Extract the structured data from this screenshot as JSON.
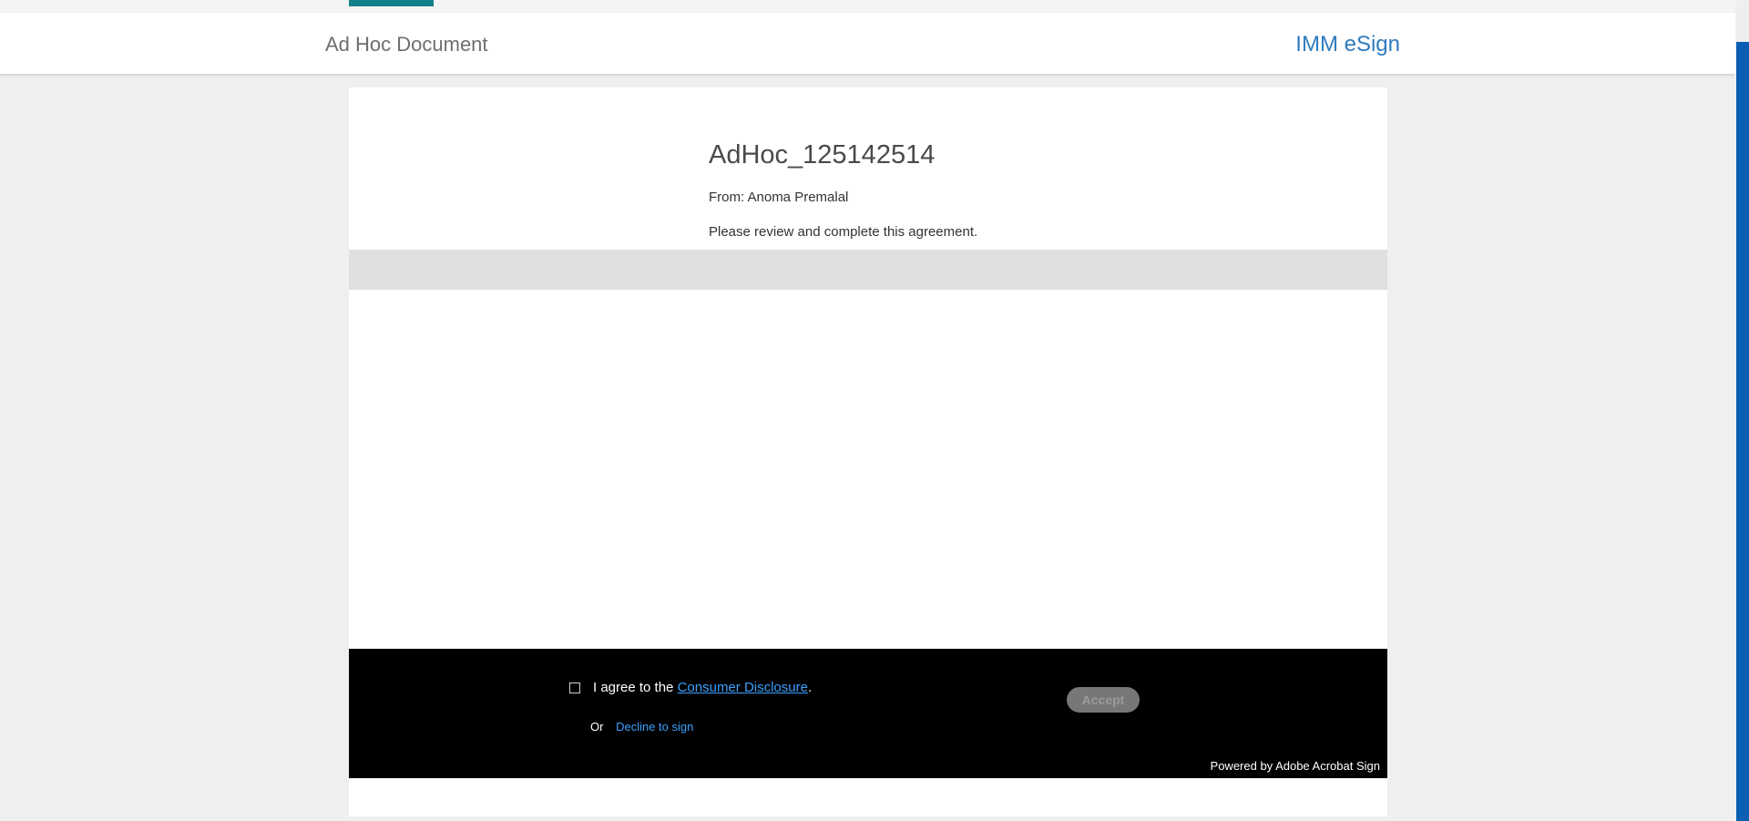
{
  "header": {
    "title": "Ad Hoc Document",
    "brand": "IMM eSign"
  },
  "document": {
    "name": "AdHoc_125142514",
    "from": "From: Anoma Premalal",
    "message": "Please review and complete this agreement."
  },
  "consent": {
    "agree_prefix": "I agree to the ",
    "disclosure_link": "Consumer Disclosure",
    "agree_suffix": ".",
    "or_label": "Or",
    "decline_link": "Decline to sign",
    "accept_label": "Accept",
    "accept_enabled": false,
    "checkbox_checked": false
  },
  "footer": {
    "powered_by": "Powered by Adobe Acrobat Sign"
  },
  "colors": {
    "accent": "#138089",
    "brand": "#2f7bbf",
    "link": "#3aa0ff",
    "scrollbar": "#0b5fb2"
  }
}
